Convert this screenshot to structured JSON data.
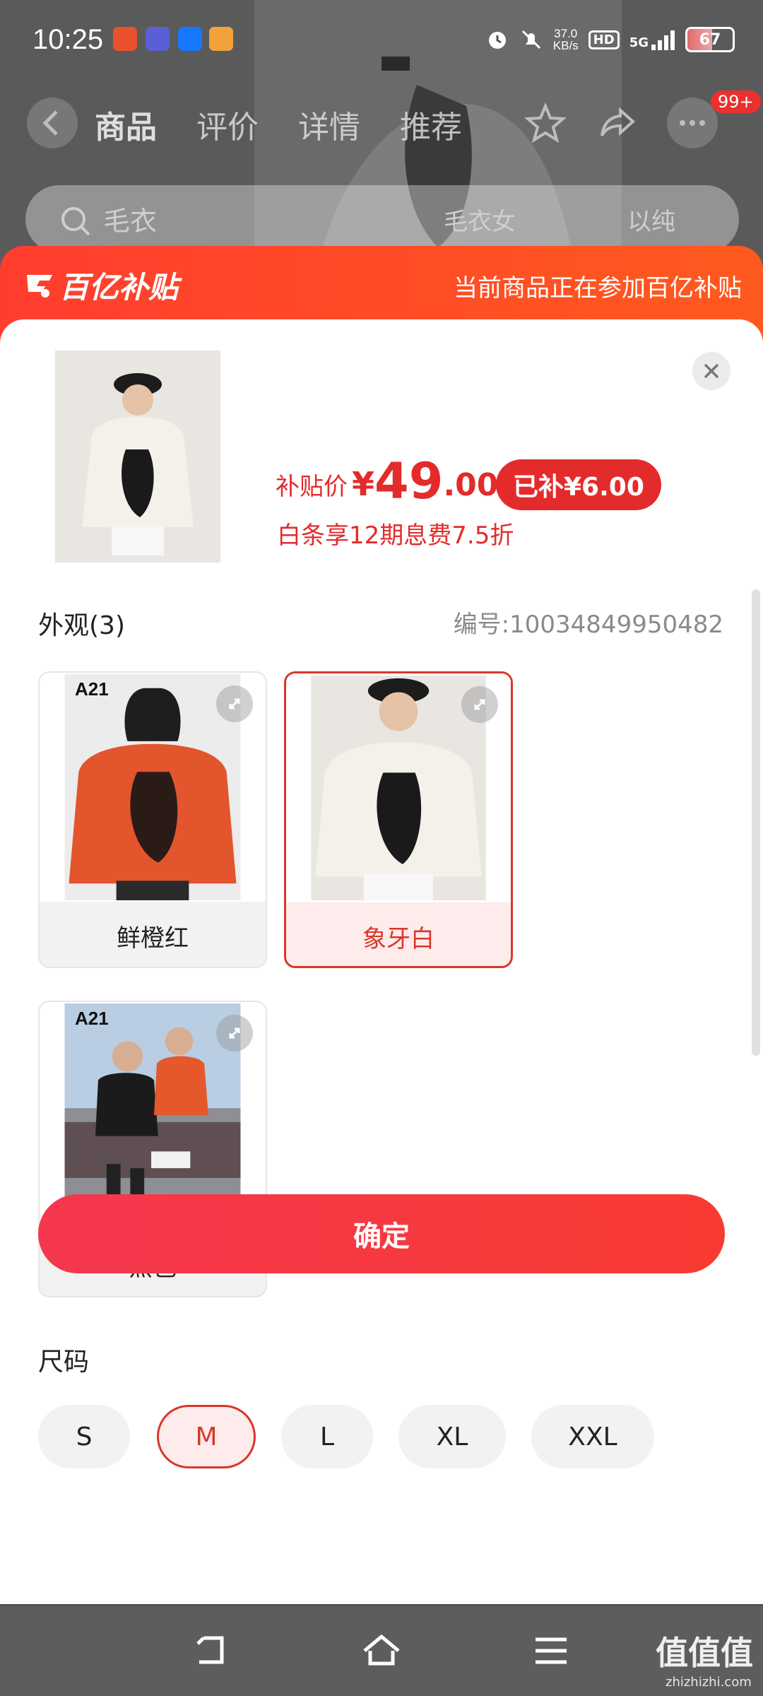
{
  "status_bar": {
    "time": "10:25",
    "net_speed_value": "37.0",
    "net_speed_unit": "KB/s",
    "hd": "HD",
    "network": "5G",
    "battery": "67"
  },
  "background_page": {
    "tabs": [
      "商品",
      "评价",
      "详情",
      "推荐"
    ],
    "message_badge": "99+",
    "search_placeholder": "毛衣",
    "search_tags": [
      "毛衣女",
      "以纯"
    ]
  },
  "subsidy_banner": {
    "logo_text": "百亿补贴",
    "notice": "当前商品正在参加百亿补贴"
  },
  "product": {
    "price_label": "补贴价",
    "currency": "¥",
    "price_integer": "49",
    "price_decimal": ".00",
    "subsidy_badge": "已补¥6.00",
    "installment": "白条享12期息费7.5折"
  },
  "appearance": {
    "title": "外观(3)",
    "sku_code": "编号:10034849950482",
    "options": [
      {
        "label": "鲜橙红",
        "code": "A21",
        "selected": false
      },
      {
        "label": "象牙白",
        "code": "",
        "selected": true
      },
      {
        "label": "黑色",
        "code": "A21",
        "selected": false
      }
    ]
  },
  "size": {
    "title": "尺码",
    "options": [
      "S",
      "M",
      "L",
      "XL",
      "XXL"
    ],
    "selected": "M"
  },
  "confirm_label": "确定",
  "watermark": {
    "main": "值值值",
    "sub": "zhizhizhi.com"
  },
  "colors": {
    "accent": "#e42b2b",
    "banner": "#ff4a25",
    "selected_bg": "#fdeceb"
  }
}
